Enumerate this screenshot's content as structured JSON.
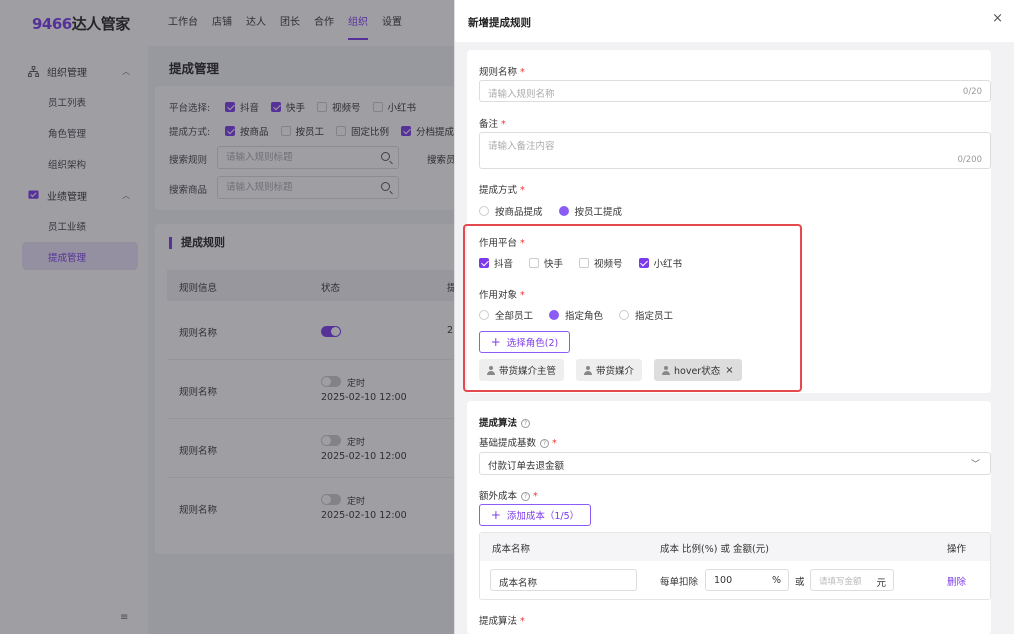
{
  "app": {
    "logo_num": "9466",
    "logo_text": "达人管家"
  },
  "nav": [
    "工作台",
    "店铺",
    "达人",
    "团长",
    "合作",
    "组织",
    "设置"
  ],
  "sidebar": {
    "group1": "组织管理",
    "group1_items": [
      "员工列表",
      "角色管理",
      "组织架构"
    ],
    "group2": "业绩管理",
    "group2_items": [
      "员工业绩",
      "提成管理"
    ],
    "collapse_icon": "≡"
  },
  "page": {
    "title": "提成管理",
    "filters": {
      "platform_label": "平台选择:",
      "platforms": [
        {
          "label": "抖音",
          "checked": true
        },
        {
          "label": "快手",
          "checked": true
        },
        {
          "label": "视频号",
          "checked": false
        },
        {
          "label": "小红书",
          "checked": false
        }
      ],
      "method_label": "提成方式:",
      "methods": [
        {
          "label": "按商品",
          "checked": true
        },
        {
          "label": "按员工",
          "checked": false
        },
        {
          "label": "固定比例",
          "checked": false
        },
        {
          "label": "分档提成",
          "checked": true
        }
      ],
      "rule_label": "搜索规则",
      "rule_placeholder": "请输入规则标题",
      "product_label": "搜索商品",
      "product_placeholder": "请输入规则标题",
      "search_right_label": "搜索员"
    },
    "table": {
      "title": "提成规则",
      "columns": [
        "规则信息",
        "状态",
        "提"
      ],
      "rows": [
        {
          "name": "规则名称",
          "status": "on",
          "timer": "",
          "date": "",
          "extra": "2"
        },
        {
          "name": "规则名称",
          "status": "off",
          "timer": "定时",
          "date": "2025-02-10 12:00",
          "extra": ""
        },
        {
          "name": "规则名称",
          "status": "off",
          "timer": "定时",
          "date": "2025-02-10 12:00",
          "extra": ""
        },
        {
          "name": "规则名称",
          "status": "off",
          "timer": "定时",
          "date": "2025-02-10 12:00",
          "extra": ""
        }
      ]
    }
  },
  "drawer": {
    "title": "新增提成规则",
    "close": "×",
    "rule_name_label": "规则名称",
    "rule_name_placeholder": "请输入规则名称",
    "rule_name_count": "0/20",
    "note_label": "备注",
    "note_placeholder": "请输入备注内容",
    "note_count": "0/200",
    "method_label": "提成方式",
    "methods": [
      {
        "label": "按商品提成",
        "selected": false
      },
      {
        "label": "按员工提成",
        "selected": true
      }
    ],
    "platform_label": "作用平台",
    "platforms": [
      {
        "label": "抖音",
        "checked": true
      },
      {
        "label": "快手",
        "checked": false
      },
      {
        "label": "视频号",
        "checked": false
      },
      {
        "label": "小红书",
        "checked": true
      }
    ],
    "target_label": "作用对象",
    "targets": [
      {
        "label": "全部员工",
        "selected": false
      },
      {
        "label": "指定角色",
        "selected": true
      },
      {
        "label": "指定员工",
        "selected": false
      }
    ],
    "select_role_btn": "选择角色(2)",
    "role_tags": [
      "带货媒介主管",
      "带货媒介",
      "hover状态"
    ],
    "algo_title": "提成算法",
    "base_label": "基础提成基数",
    "base_value": "付款订单去退金额",
    "extra_cost_label": "额外成本",
    "add_cost_btn": "添加成本（1/5）",
    "cost_table": {
      "col_name": "成本名称",
      "col_value": "成本 比例(%) 或 金额(元)",
      "col_op": "操作",
      "row_name": "成本名称",
      "deduct_label": "每单扣除",
      "percent_value": "100",
      "percent_unit": "%",
      "or_label": "或",
      "amount_placeholder": "请填写金额",
      "amount_unit": "元",
      "delete": "删除"
    },
    "algo_label2": "提成算法"
  },
  "colors": {
    "accent": "#7c3aed",
    "highlight": "#e5484d"
  }
}
